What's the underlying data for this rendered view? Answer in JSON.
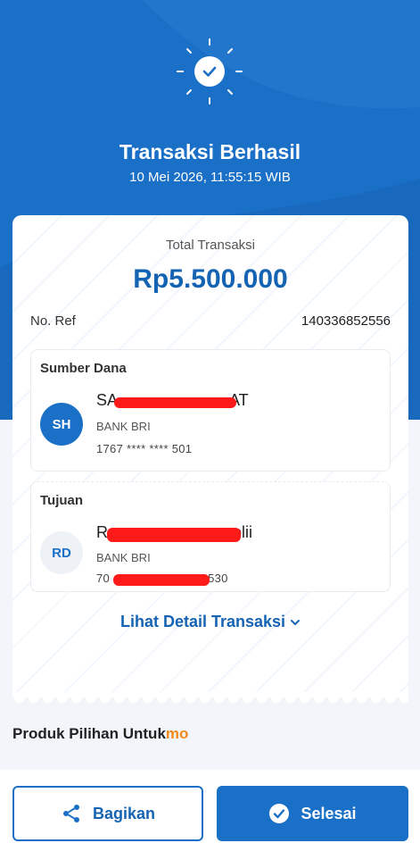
{
  "header": {
    "title": "Transaksi Berhasil",
    "timestamp": "10 Mei 2026, 11:55:15 WIB",
    "status_icon": "check-circle-icon"
  },
  "summary": {
    "total_label": "Total Transaksi",
    "total_value": "Rp5.500.000",
    "ref_label": "No. Ref",
    "ref_value": "140336852556"
  },
  "source": {
    "heading": "Sumber Dana",
    "initials": "SH",
    "name_start": "SA",
    "name_end": "AT",
    "bank": "BANK BRI",
    "account": "1767 **** **** 501"
  },
  "destination": {
    "heading": "Tujuan",
    "initials": "RD",
    "name_start": "R",
    "name_end": "olii",
    "bank": "BANK BRI",
    "account_start": "70",
    "account_end": "530"
  },
  "detail_link": "Lihat Detail Transaksi",
  "product": {
    "label": "Produk Pilihan Untuk",
    "brand": "mo"
  },
  "buttons": {
    "share_label": "Bagikan",
    "done_label": "Selesai"
  },
  "colors": {
    "primary": "#1a6fc6",
    "redaction": "#ff1a1a",
    "brand_orange": "#f28a1c"
  }
}
